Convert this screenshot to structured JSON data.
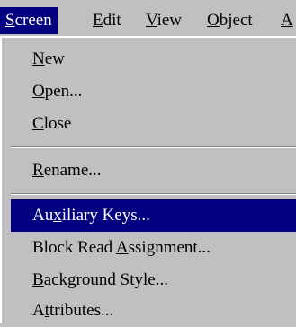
{
  "menubar": {
    "items": [
      {
        "pre": "",
        "key": "S",
        "post": "creen",
        "active": true
      },
      {
        "pre": "",
        "key": "E",
        "post": "dit",
        "active": false
      },
      {
        "pre": "",
        "key": "V",
        "post": "iew",
        "active": false
      },
      {
        "pre": "",
        "key": "O",
        "post": "bject",
        "active": false
      },
      {
        "pre": "",
        "key": "A",
        "post": "",
        "active": false
      }
    ]
  },
  "dropdown": {
    "items": [
      {
        "pre": "",
        "key": "N",
        "post": "ew"
      },
      {
        "pre": "",
        "key": "O",
        "post": "pen..."
      },
      {
        "pre": "",
        "key": "C",
        "post": "lose"
      },
      {
        "pre": "",
        "key": "R",
        "post": "ename..."
      },
      {
        "pre": "Au",
        "key": "x",
        "post": "iliary Keys..."
      },
      {
        "pre": "Block Read ",
        "key": "A",
        "post": "ssignment..."
      },
      {
        "pre": "",
        "key": "B",
        "post": "ackground Style..."
      },
      {
        "pre": "A",
        "key": "t",
        "post": "tributes..."
      }
    ]
  },
  "colors": {
    "menu_background": "#c0c0c0",
    "highlight": "#000080",
    "highlight_text": "#ffffff"
  }
}
